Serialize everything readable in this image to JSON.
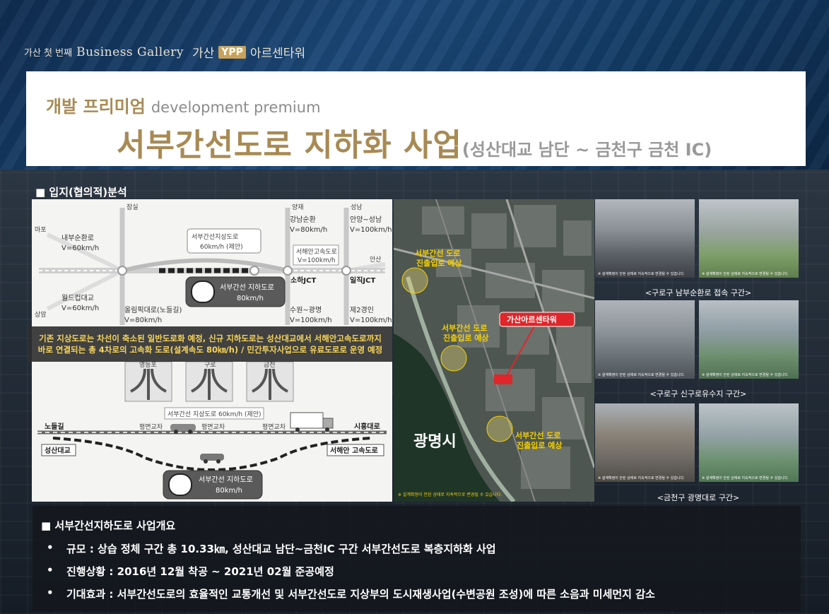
{
  "brand": {
    "tagline": "가산 첫 번째",
    "gallery": "Business Gallery",
    "place": "가산",
    "ypp": "YPP",
    "tower": "아르센타워"
  },
  "header": {
    "kicker_ko": "개발 프리미엄",
    "kicker_en": "development premium",
    "title": "서부간선도로 지하화 사업",
    "title_sub": "(성산대교 남단 ~ 금천구 금천 IC)"
  },
  "analysis": {
    "title": "■ 입지(협의적)분석"
  },
  "diagram": {
    "top": {
      "nodes": [
        "마포",
        "잠실",
        "양재",
        "성남",
        "안산",
        "상암"
      ],
      "roads": [
        {
          "name": "내부순환로",
          "speed": "V=60km/h"
        },
        {
          "name": "월드컵대교",
          "speed": "V=60km/h"
        },
        {
          "name": "올림픽대로(노들길)",
          "speed": "V=80km/h"
        },
        {
          "name": "강남순환",
          "speed": "V=80km/h"
        },
        {
          "name": "안양~성남",
          "speed": "V=100km/h"
        },
        {
          "name": "서해안고속도로",
          "speed": "V=100km/h"
        },
        {
          "name": "수원~광명",
          "speed": "V=100km/h"
        },
        {
          "name": "제2경인",
          "speed": "V=100km/h"
        }
      ],
      "callout_title": "서부간선지상도로",
      "callout_speed": "60km/h (제안)",
      "tunnel_label": "서부간선 지하도로",
      "tunnel_speed": "80km/h",
      "junctions": [
        "소하JCT",
        "일직JCT"
      ]
    },
    "banner_line1": "기존 지상도로는 차선이 축소된 일반도로화 예정, 신규 지하도로는 성산대교에서 서해안고속도로까지",
    "banner_line2": "바로 연결되는 총 4차로의 고속화 도로(설계속도 80㎞/h) / 민간투자사업으로 유료도로로 운영 예정",
    "ramps": [
      "영등포",
      "구로",
      "금천"
    ],
    "bottom": {
      "surface_label": "서부간선 지상도로 60km/h (제안)",
      "left_top": "노들길",
      "left_bottom": "성산대교",
      "right_top": "시흥대로",
      "right_bottom": "서해안 고속도로",
      "crossings": [
        "평면교차",
        "평면교차",
        "평면교차"
      ],
      "tunnel_label": "서부간선 지하도로",
      "tunnel_speed": "80km/h"
    }
  },
  "map": {
    "tower_label": "가산아르센타워",
    "entry_label_1": "서부간선 도로",
    "entry_label_2": "진출입로 예상",
    "city_label": "광명시",
    "note": "※ 설계확정이 안된 상태로 지속적으로 변경될 수 있습니다."
  },
  "photos": {
    "note": "※ 설계확정이 안된 상태로 지속적으로 변경될 수 있습니다.",
    "captions": [
      "<구로구 남부순환로 접속 구간>",
      "<구로구 신구로유수지 구간>",
      "<금천구 광명대로 구간>"
    ]
  },
  "overview": {
    "title": "■ 서부간선지하도로 사업개요",
    "items": [
      {
        "bullet": "•",
        "text": "규모 : 상습 정체 구간 총 10.33㎞, 성산대교 남단~금천IC 구간 서부간선도로 복층지하화 사업"
      },
      {
        "bullet": "•",
        "text": "진행상황 : 2016년 12월 착공 ~ 2021년 02월 준공예정"
      },
      {
        "bullet": "•",
        "text": "기대효과 : 서부간선도로의 효율적인 교통개선 및 서부간선도로 지상부의 도시재생사업(수변공원 조성)에 따른 소음과 미세먼지 감소"
      }
    ]
  },
  "colors": {
    "gold": "#a88a54",
    "banner_text": "#f6d55a",
    "map_label": "#f5d000",
    "tower_badge": "#e0262a"
  }
}
